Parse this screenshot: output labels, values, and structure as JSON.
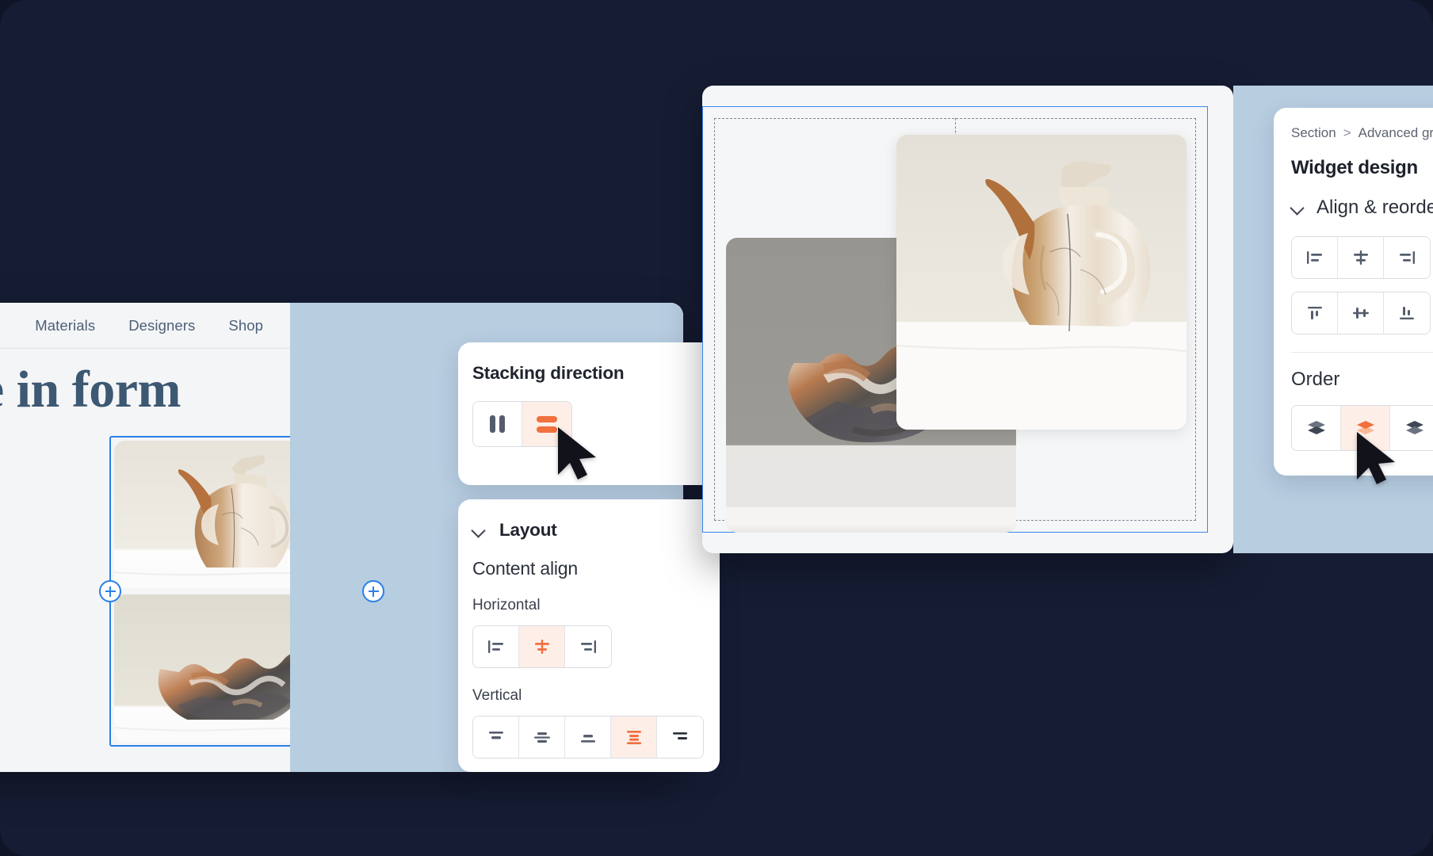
{
  "theme": {
    "background": "#161c33",
    "accent_orange": "#f0703e",
    "accent_blue": "#2a7fe8",
    "panel_blue": "#b7cde0",
    "site_surface": "#f4f5f7",
    "heading_color": "#3d5872"
  },
  "site_preview": {
    "nav": [
      {
        "label": "Materials"
      },
      {
        "label": "Designers"
      },
      {
        "label": "Shop"
      }
    ],
    "headline": "sterpiece in form",
    "gallery": {
      "selected": true,
      "images": [
        {
          "name": "marble-jug-image",
          "alt": "Marble jug with curved spout"
        },
        {
          "name": "marble-bowl-image",
          "alt": "Marble wavy bowl"
        }
      ],
      "left_peek": {
        "name": "marble-vase-image",
        "alt": "Marble vase detail"
      },
      "handles": [
        {
          "name": "add-handle-left",
          "icon": "plus-icon"
        },
        {
          "name": "add-handle-right",
          "icon": "plus-icon"
        }
      ]
    }
  },
  "stacking_card": {
    "title": "Stacking direction",
    "options": [
      {
        "name": "stack-horizontal",
        "icon": "vertical-bars-icon",
        "active": false
      },
      {
        "name": "stack-vertical",
        "icon": "horizontal-bars-icon",
        "active": true
      }
    ]
  },
  "layout_card": {
    "title": "Layout",
    "collapse_icon": "chevron-down-icon",
    "content_align_label": "Content align",
    "horizontal": {
      "label": "Horizontal",
      "options": [
        {
          "name": "align-left",
          "icon": "align-left-icon",
          "active": false
        },
        {
          "name": "align-center",
          "icon": "align-center-icon",
          "active": true
        },
        {
          "name": "align-right",
          "icon": "align-right-icon",
          "active": false
        }
      ]
    },
    "vertical": {
      "label": "Vertical",
      "options": [
        {
          "name": "valign-top",
          "icon": "valign-top-icon",
          "active": false
        },
        {
          "name": "valign-middle",
          "icon": "valign-middle-icon",
          "active": false
        },
        {
          "name": "valign-bottom",
          "icon": "valign-bottom-icon",
          "active": false
        },
        {
          "name": "valign-stretch",
          "icon": "valign-stretch-icon",
          "active": true
        },
        {
          "name": "valign-more",
          "icon": "valign-more-icon",
          "active": false
        }
      ]
    }
  },
  "canvas": {
    "selection_visible": true,
    "guides_visible": true,
    "images": [
      {
        "name": "canvas-bowl-image",
        "alt": "Marble wavy bowl on grey backdrop"
      },
      {
        "name": "canvas-jug-image",
        "alt": "Marble jug with curved spout"
      }
    ]
  },
  "widget_panel": {
    "breadcrumb": {
      "parent": "Section",
      "separator": ">",
      "current": "Advanced gri"
    },
    "title": "Widget design",
    "section": {
      "label": "Align & reorde",
      "collapse_icon": "chevron-down-icon"
    },
    "align_horizontal": [
      {
        "name": "align-left",
        "icon": "align-left-icon",
        "active": false
      },
      {
        "name": "align-center",
        "icon": "align-center-icon",
        "active": false
      },
      {
        "name": "align-right",
        "icon": "align-right-icon",
        "active": false
      }
    ],
    "align_vertical": [
      {
        "name": "valign-top",
        "icon": "valign-top-icon",
        "active": false
      },
      {
        "name": "valign-middle",
        "icon": "valign-middle-icon",
        "active": false
      },
      {
        "name": "valign-bottom",
        "icon": "valign-bottom-icon",
        "active": false
      }
    ],
    "order": {
      "label": "Order",
      "options": [
        {
          "name": "order-send-backward",
          "icon": "layers-back-icon",
          "active": false
        },
        {
          "name": "order-bring-forward",
          "icon": "layers-front-icon",
          "active": true
        },
        {
          "name": "order-bring-to-front",
          "icon": "layers-top-icon",
          "active": false
        }
      ]
    }
  },
  "cursors": [
    {
      "name": "pointer-cursor-stacking"
    },
    {
      "name": "pointer-cursor-order"
    }
  ]
}
